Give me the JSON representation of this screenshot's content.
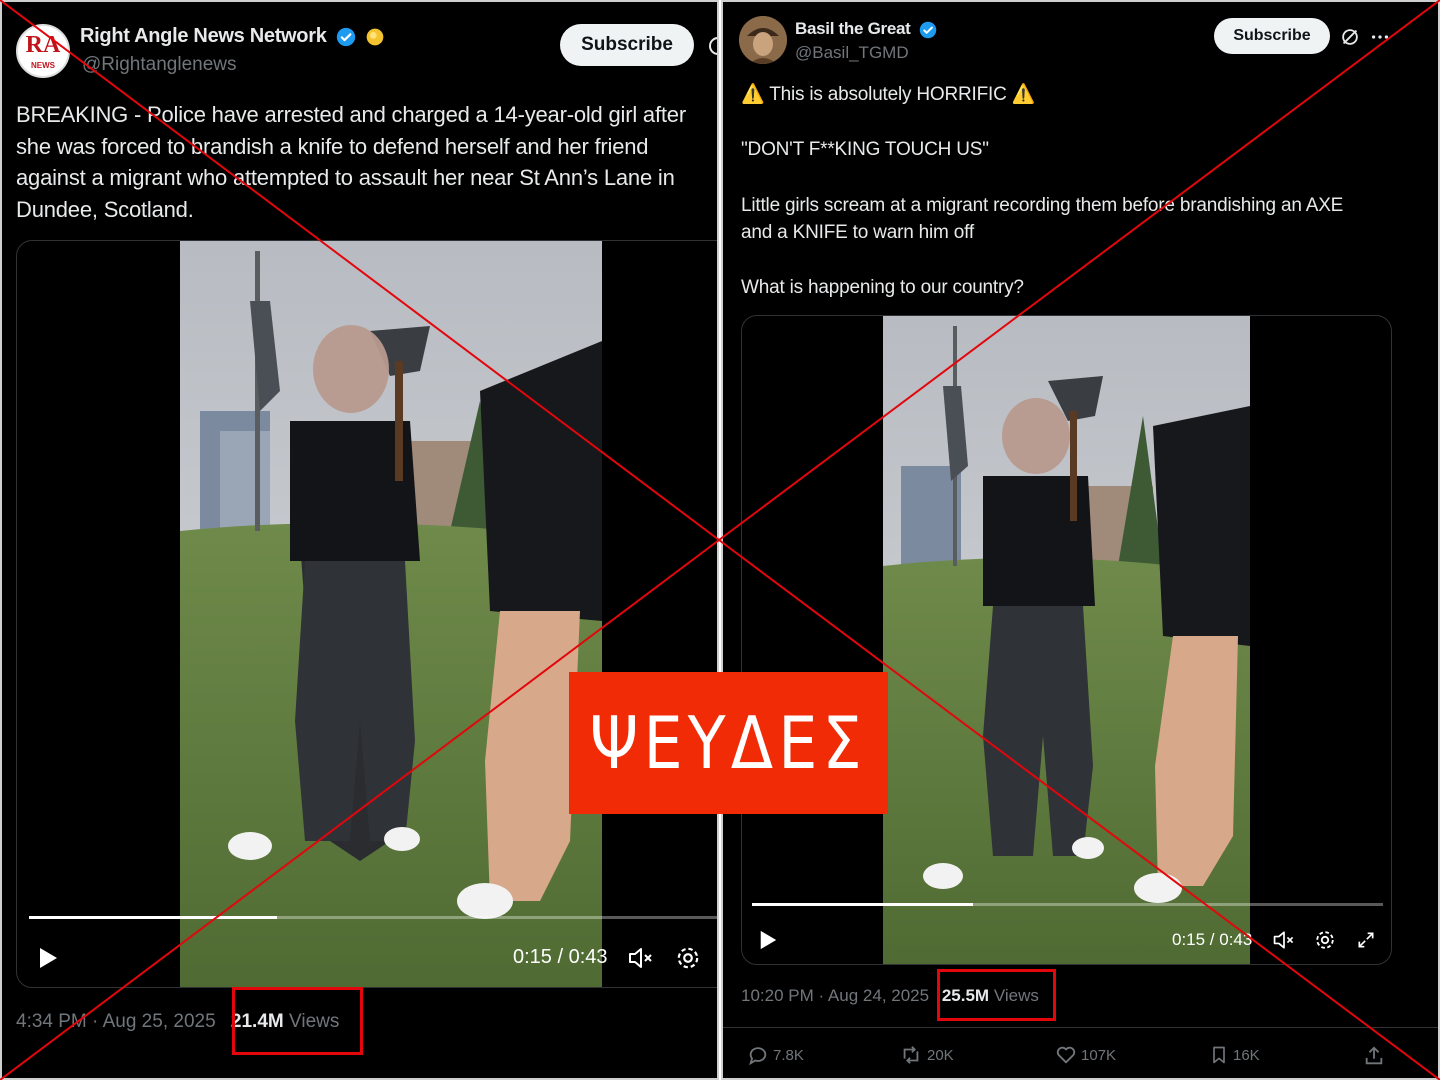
{
  "left_tweet": {
    "display_name": "Right Angle News Network",
    "handle": "@Rightanglenews",
    "avatar_logo_text": "RA",
    "avatar_logo_sub": "NEWS",
    "subscribe_label": "Subscribe",
    "text": "BREAKING - Police have arrested and charged a 14-year-old girl after\nshe was forced to brandish a knife to defend herself and her friend\nagainst a migrant who attempted to assault her near St Ann’s Lane in\nDundee, Scotland.",
    "video_time": "0:15 / 0:43",
    "video_progress": 0.35,
    "timestamp": "4:34 PM · Aug 25, 2025",
    "views_count": "21.4M",
    "views_label": "Views"
  },
  "right_tweet": {
    "display_name": "Basil the Great",
    "handle": "@Basil_TGMD",
    "subscribe_label": "Subscribe",
    "line1": "⚠️ This is absolutely HORRIFIC ⚠️",
    "line2": "\"DON'T F**KING TOUCH US\"",
    "line3": "Little girls scream at a migrant recording them before brandishing an AXE\nand a KNIFE to warn him off",
    "line4": "What is happening to our country?",
    "video_time": "0:15 / 0:43",
    "video_progress": 0.35,
    "timestamp": "10:20 PM · Aug 24, 2025",
    "views_count": "25.5M",
    "views_label": "Views",
    "actions": {
      "replies": "7.8K",
      "reposts": "20K",
      "likes": "107K",
      "bookmarks": "16K"
    }
  },
  "stamp": {
    "label": "ΨΕΥΔΕΣ",
    "color": "#f12b05"
  },
  "colors": {
    "cross": "#e3060b",
    "highlight": "#e3060b",
    "verified": "#1d9bf0"
  }
}
